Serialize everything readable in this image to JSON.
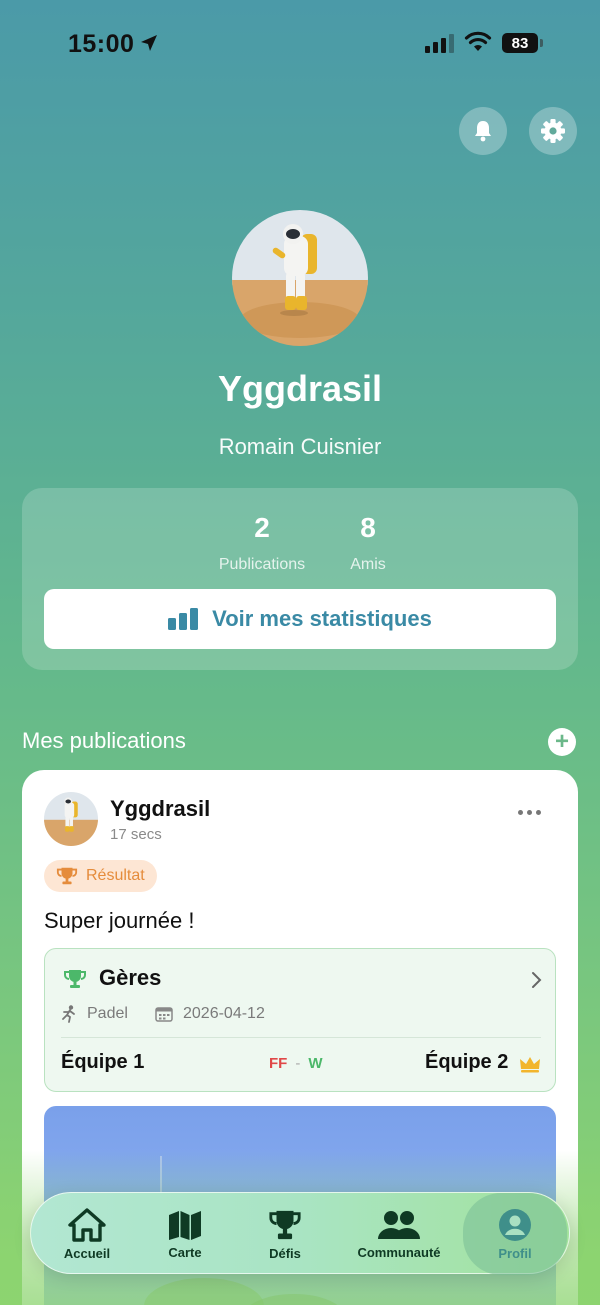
{
  "status_bar": {
    "time": "15:00",
    "battery": "83"
  },
  "profile": {
    "username": "Yggdrasil",
    "full_name": "Romain Cuisnier",
    "stats": [
      {
        "value": "2",
        "label": "Publications"
      },
      {
        "value": "8",
        "label": "Amis"
      }
    ],
    "stats_button_label": "Voir mes statistiques"
  },
  "publications": {
    "section_title": "Mes publications",
    "add_label": "+",
    "posts": [
      {
        "author": "Yggdrasil",
        "time": "17 secs",
        "badge": "Résultat",
        "text": "Super journée !",
        "result": {
          "title": "Gères",
          "sport": "Padel",
          "date": "2026-04-12",
          "team1": "Équipe 1",
          "team2": "Équipe 2",
          "score_left": "FF",
          "score_sep": "-",
          "score_right": "W"
        }
      }
    ]
  },
  "tabbar": {
    "items": [
      {
        "label": "Accueil",
        "icon": "home-icon"
      },
      {
        "label": "Carte",
        "icon": "map-icon"
      },
      {
        "label": "Défis",
        "icon": "trophy-icon"
      },
      {
        "label": "Communauté",
        "icon": "users-icon"
      },
      {
        "label": "Profil",
        "icon": "user-icon",
        "active": true
      }
    ]
  },
  "colors": {
    "accent": "#3a8aa5",
    "loss": "#e04848",
    "win": "#4cb86a",
    "badge_bg": "#fde6d4",
    "badge_fg": "#e58c3c"
  }
}
